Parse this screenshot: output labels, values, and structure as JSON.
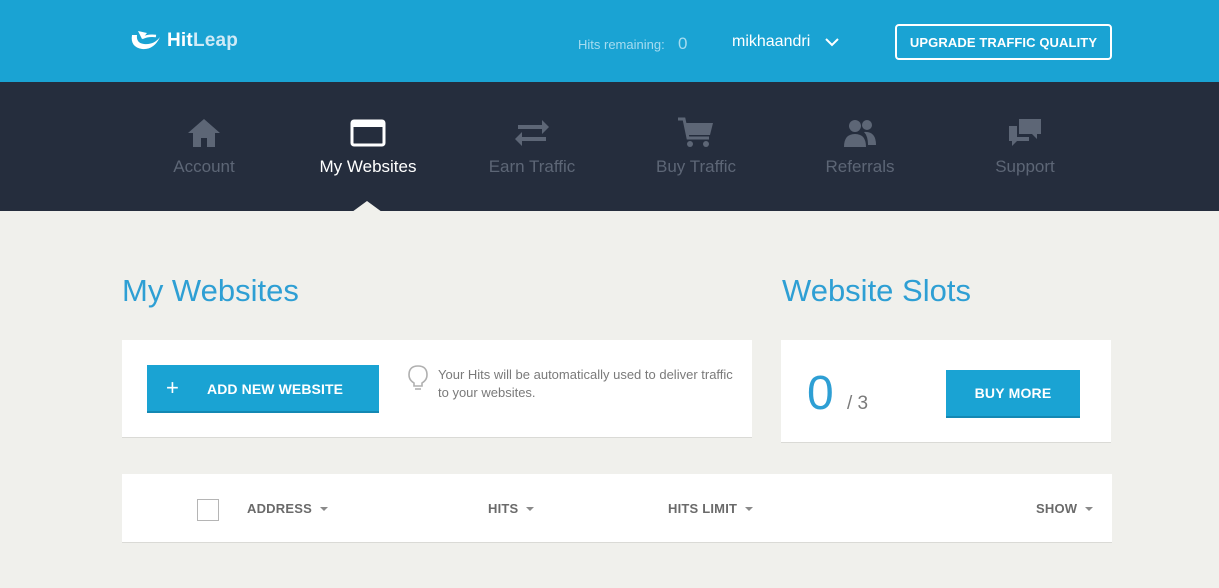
{
  "brand": {
    "name_part1": "Hit",
    "name_part2": "Leap",
    "accent_color": "#1aa3d3",
    "nav_bg": "#252d3d"
  },
  "header": {
    "hits_label": "Hits remaining:",
    "hits_value": "0",
    "username": "mikhaandri",
    "upgrade_label": "UPGRADE TRAFFIC QUALITY"
  },
  "nav": {
    "items": [
      {
        "label": "Account",
        "icon": "home-icon",
        "active": false
      },
      {
        "label": "My Websites",
        "icon": "browser-window-icon",
        "active": true
      },
      {
        "label": "Earn Traffic",
        "icon": "exchange-arrows-icon",
        "active": false
      },
      {
        "label": "Buy Traffic",
        "icon": "shopping-cart-icon",
        "active": false
      },
      {
        "label": "Referrals",
        "icon": "users-icon",
        "active": false
      },
      {
        "label": "Support",
        "icon": "chat-bubbles-icon",
        "active": false
      }
    ]
  },
  "websites": {
    "title": "My Websites",
    "add_button": {
      "icon": "+",
      "label": "ADD NEW WEBSITE"
    },
    "tip": "Your Hits will be automatically used to deliver traffic to your websites."
  },
  "slots": {
    "title": "Website Slots",
    "used": "0",
    "total": "/ 3",
    "buy_label": "BUY MORE"
  },
  "table": {
    "columns": [
      "ADDRESS",
      "HITS",
      "HITS LIMIT",
      "SHOW"
    ]
  }
}
